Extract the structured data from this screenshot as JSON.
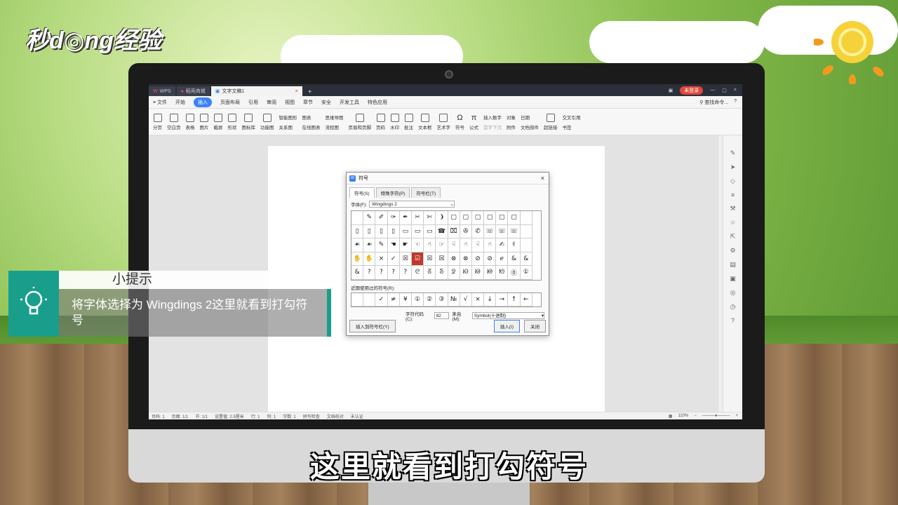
{
  "logo": "秒d◎ng经验",
  "wps": {
    "tabs": [
      "WPS",
      "稻壳商城",
      "文字文稿1"
    ],
    "login": "未登录",
    "menu": [
      "≡ 文件",
      "开始",
      "插入",
      "页面布局",
      "引用",
      "审阅",
      "视图",
      "章节",
      "安全",
      "开发工具",
      "特色应用"
    ],
    "search": "查找命令...",
    "ribbon": [
      "分页",
      "空白页",
      "表格",
      "图片",
      "截屏",
      "形状",
      "图标库",
      "功能图",
      "智能图形",
      "关系图",
      "图表",
      "在线图表",
      "思维导图",
      "流程图",
      "页眉和页脚",
      "页码",
      "水印",
      "批注",
      "文本框",
      "艺术字",
      "符号",
      "公式",
      "插入数字",
      "首字下沉",
      "对象",
      "附件",
      "日期",
      "文档部件",
      "超链接",
      "交叉引用",
      "书签"
    ],
    "status_left": [
      "页码: 1",
      "页面: 1/1",
      "节: 1/1",
      "设置值: 2.5厘米",
      "行: 1",
      "列: 1",
      "字数: 1",
      "拼写检查",
      "文档校对",
      "未认证"
    ],
    "zoom": "110%"
  },
  "dialog": {
    "title": "符号",
    "tabs": [
      "符号(S)",
      "特殊字符(P)",
      "符号栏(T)"
    ],
    "font_label": "字体(F):",
    "font_value": "Wingdings 2",
    "symbols": [
      "",
      "✎",
      "✐",
      "✑",
      "✒",
      "✂",
      "✄",
      "❩",
      "▢",
      "▢",
      "▢",
      "▢",
      "▢",
      "▢",
      "",
      "▯",
      "▯",
      "▯",
      "▯",
      "▭",
      "▭",
      "▭",
      "☎",
      "⌧",
      "✇",
      "✆",
      "☏",
      "☏",
      "☏",
      "",
      "☙",
      "☙",
      "✎",
      "☚",
      "☛",
      "☜",
      "☝",
      "☞",
      "☟",
      "☝",
      "☟",
      "☝",
      "✍",
      "✌",
      "",
      "✋",
      "✋",
      "×",
      "✓",
      "☒",
      "☑",
      "☒",
      "☒",
      "⊗",
      "⊗",
      "⊘",
      "⊘",
      "ℯ",
      "&",
      "&",
      "&",
      "?",
      "?",
      "?",
      "?",
      "ᘓ",
      "ᘔ",
      "ᘕ",
      "ᘖ",
      "ᘗ",
      "ᘘ",
      "ᘙ",
      "ᘚ",
      "⓪",
      "①"
    ],
    "selected_index": 50,
    "recent_label": "近期使用过的符号(R):",
    "recent": [
      "",
      "",
      "✓",
      "≠",
      "¥",
      "①",
      "②",
      "③",
      "№",
      "√",
      "×",
      "↓",
      "→",
      "↑",
      "←"
    ],
    "code_label": "字符代码(C):",
    "code_value": "82",
    "from_label": "来自(M):",
    "from_value": "Symbol(十进制)",
    "btn_insert_bar": "插入到符号栏(Y)",
    "btn_insert": "插入(I)",
    "btn_close": "关闭"
  },
  "tip": {
    "title": "小提示",
    "body": "将字体选择为 Wingdings 2这里就看到打勾符号"
  },
  "subtitle": "这里就看到打勾符号"
}
